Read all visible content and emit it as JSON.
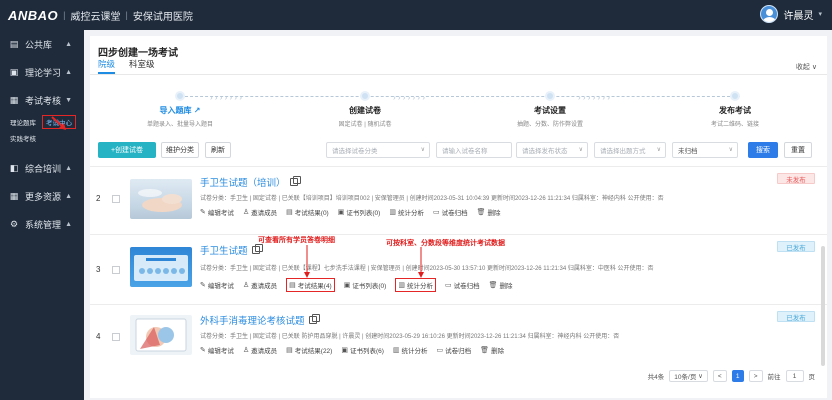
{
  "header": {
    "logo": "ANBAO",
    "brand": "威控云课堂",
    "org": "安保试用医院",
    "user": "许晨灵"
  },
  "sidebar": {
    "items": [
      {
        "label": "公共库",
        "icon": "briefcase-icon"
      },
      {
        "label": "理论学习",
        "icon": "book-icon"
      },
      {
        "label": "考试考核",
        "icon": "exam-icon"
      },
      {
        "label": "综合培训",
        "icon": "training-icon"
      },
      {
        "label": "更多资源",
        "icon": "grid-icon"
      },
      {
        "label": "系统管理",
        "icon": "gear-icon"
      }
    ],
    "sub_items": [
      "理论题库",
      "考试中心",
      "实践考核"
    ]
  },
  "panel": {
    "title": "四步创建一场考试",
    "tabs": [
      "院级",
      "科室级"
    ],
    "collapse": "收起"
  },
  "steps": [
    {
      "name": "导入题库",
      "desc": "单题录入、批量导入题目",
      "link": true
    },
    {
      "name": "创建试卷",
      "desc": "固定试卷 | 随机试卷",
      "link": false
    },
    {
      "name": "考试设置",
      "desc": "抽题、分数、防作弊设置",
      "link": false
    },
    {
      "name": "发布考试",
      "desc": "考试二维码、链接",
      "link": false
    }
  ],
  "toolbar": {
    "create": "+创建试卷",
    "manage_category": "维护分类",
    "refresh": "刷新",
    "filters": [
      "请选择试卷分类",
      "请输入试卷名称",
      "请选择发布状态",
      "请选择出题方式",
      "未归档"
    ],
    "search": "搜索",
    "reset": "重置"
  },
  "rows": [
    {
      "index": "2",
      "title": "手卫生试题（培训）",
      "meta": "试卷分类：手卫生 | 固定试卷 | 已关联【培训项目】培训项目002 | 安保管理员 | 创建时间2023-05-31 10:04:39   更新时间2023-12-26 11:21:34   归属科室：神经内科   公开使用：否",
      "actions": [
        "编辑考试",
        "邀请成员",
        "考试结果(0)",
        "证书列表(0)",
        "统计分析",
        "试卷归档",
        "删除"
      ],
      "status": "未发布"
    },
    {
      "index": "3",
      "title": "手卫生试题",
      "meta": "试卷分类：手卫生 | 固定试卷 | 已关联【课程】七步洗手法课程 | 安保管理员 | 创建时间2023-05-30 13:57:10   更新时间2023-12-26 11:21:34   归属科室：中医科   公开使用：否",
      "actions": [
        "编辑考试",
        "邀请成员",
        "考试结果(4)",
        "证书列表(0)",
        "统计分析",
        "试卷归档",
        "删除"
      ],
      "status": "已发布"
    },
    {
      "index": "4",
      "title": "外科手消毒理论考核试题",
      "meta": "试卷分类：手卫生 | 固定试卷 | 已关联 防护用品穿脱 | 许晨灵 | 创建时间2023-05-29 16:10:26   更新时间2023-12-26 11:21:34   归属科室：神经内科   公开使用：否",
      "actions": [
        "编辑考试",
        "邀请成员",
        "考试结果(22)",
        "证书列表(6)",
        "统计分析",
        "试卷归档",
        "删除"
      ],
      "status": "已发布"
    }
  ],
  "annotations": {
    "a1": "可查看所有学员答卷明细",
    "a2": "可按科室、分数段等维度统计考试数据"
  },
  "pager": {
    "total": "共4条",
    "size": "10条/页",
    "prev": "<",
    "current": "1",
    "next": ">",
    "goto": "前往",
    "page": "1",
    "unit": "页"
  },
  "colors": {
    "accent": "#2d7ce8",
    "teal": "#26b3c4",
    "sidebar": "#1f2b3a",
    "annotation": "#e01e1e"
  }
}
